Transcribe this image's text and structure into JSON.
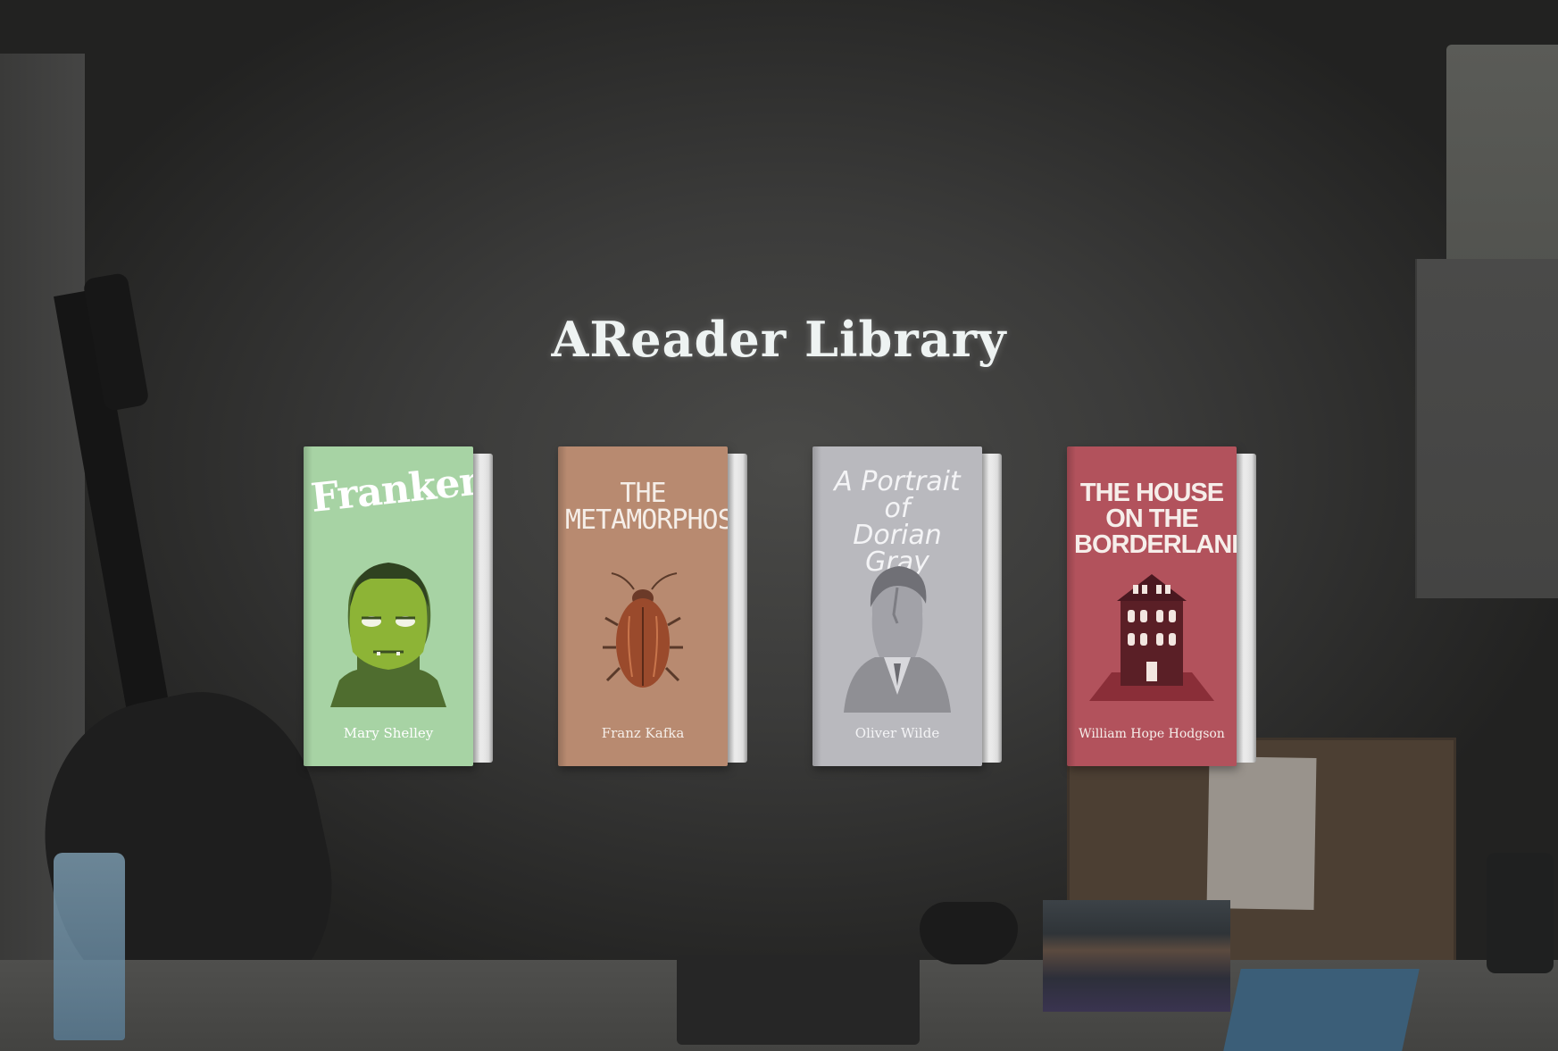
{
  "app": {
    "title": "AReader Library"
  },
  "books": [
    {
      "title": "Frankenstein",
      "author": "Mary Shelley",
      "cover_color": "#a7d3a4",
      "illustration": "monster-face"
    },
    {
      "title": "THE\nMETAMORPHOSIS",
      "author": "Franz Kafka",
      "cover_color": "#b88a70",
      "illustration": "beetle"
    },
    {
      "title": "A Portrait\nof\nDorian Gray",
      "author": "Oliver Wilde",
      "cover_color": "#b9b9be",
      "illustration": "gentleman-portrait"
    },
    {
      "title": "THE HOUSE\nON THE\nBORDERLAND",
      "author": "William Hope Hodgson",
      "cover_color": "#b2525c",
      "illustration": "victorian-house"
    }
  ]
}
